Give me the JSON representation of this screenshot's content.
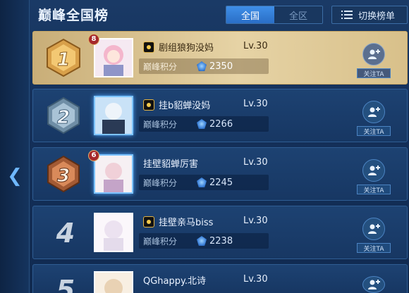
{
  "header": {
    "title": "巅峰全国榜",
    "scope_tabs": [
      {
        "label": "全国",
        "active": true
      },
      {
        "label": "全区",
        "active": false
      }
    ],
    "switch_button": "切换榜单"
  },
  "score_label": "巅峰积分",
  "follow_label": "关注TA",
  "rows": [
    {
      "rank": "1",
      "badge": "8",
      "name": "剧组狼狗没妈",
      "level": "Lv.30",
      "score": "2350",
      "has_name_icon": true
    },
    {
      "rank": "2",
      "badge": "",
      "name": "挂b貂蝉没妈",
      "level": "Lv.30",
      "score": "2266",
      "has_name_icon": true
    },
    {
      "rank": "3",
      "badge": "6",
      "name": "挂壁貂蝉厉害",
      "level": "Lv.30",
      "score": "2245",
      "has_name_icon": false
    },
    {
      "rank": "4",
      "badge": "",
      "name": "挂壁亲马biss",
      "level": "Lv.30",
      "score": "2238",
      "has_name_icon": true
    },
    {
      "rank": "5",
      "badge": "",
      "name": "QGhappy.北诗",
      "level": "Lv.30",
      "score": "",
      "has_name_icon": false
    }
  ],
  "colors": {
    "background": "#14305a",
    "gold_row": "#e6d3a5",
    "accent": "#3f8fe8"
  },
  "icons": {
    "back": "chevron-left-icon",
    "switch": "list-icon",
    "follow": "add-friend-icon",
    "score": "rank-gem-icon"
  }
}
